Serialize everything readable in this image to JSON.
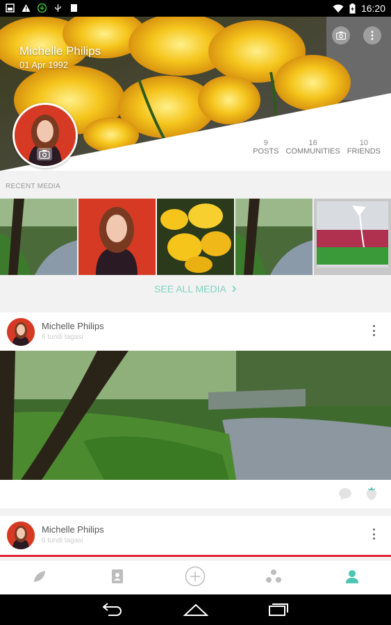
{
  "status_bar": {
    "time": "16:20",
    "icons": [
      "image-icon",
      "warning-icon",
      "download-icon",
      "usb-icon",
      "clipboard-icon",
      "wifi-icon",
      "battery-icon"
    ]
  },
  "profile": {
    "name": "Michelle Philips",
    "dob": "01 Apr 1992",
    "stats": [
      {
        "count": "9",
        "label": "POSTS"
      },
      {
        "count": "16",
        "label": "COMMUNITIES"
      },
      {
        "count": "10",
        "label": "FRIENDS"
      }
    ]
  },
  "recent_media": {
    "label": "RECENT MEDIA",
    "see_all": "SEE ALL MEDIA"
  },
  "posts": [
    {
      "author": "Michelle Philips",
      "time": "6 tundi tagasi"
    },
    {
      "author": "Michelle Philips",
      "time": "6 tundi tagasi"
    }
  ],
  "colors": {
    "accent": "#4dc5b0",
    "link": "#7fd4c1"
  }
}
